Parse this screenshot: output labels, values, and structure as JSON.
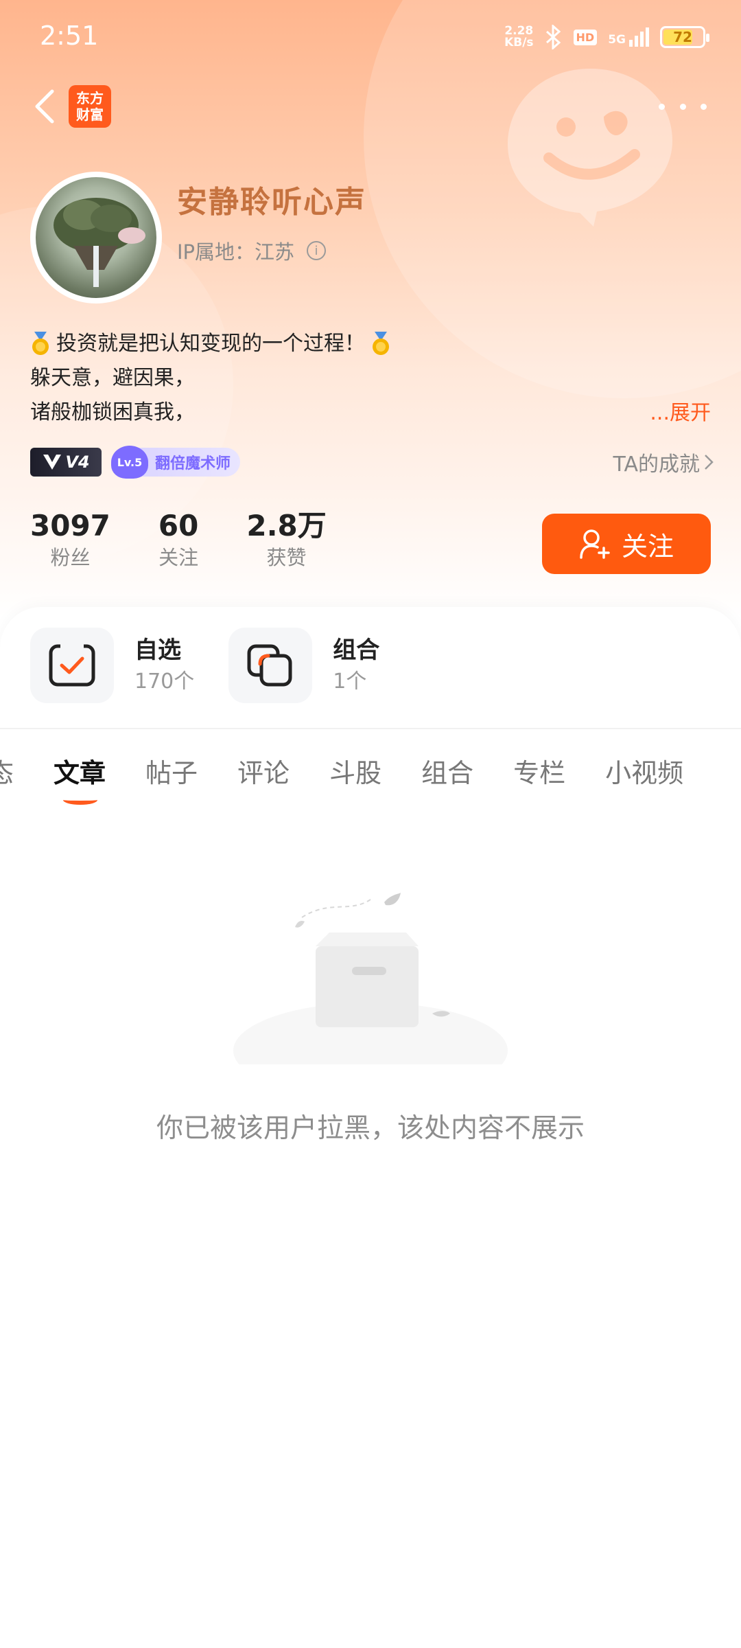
{
  "status_bar": {
    "time": "2:51",
    "net_speed_value": "2.28",
    "net_speed_unit": "KB/s",
    "hd": "HD",
    "signal": "5G",
    "battery": "72"
  },
  "nav": {
    "logo_line1": "东方",
    "logo_line2": "财富"
  },
  "profile": {
    "username": "安静聆听心声",
    "ip_location": "IP属地：江苏",
    "bio_lines": [
      "投资就是把认知变现的一个过程！",
      "躲天意，避因果，",
      "诸般枷锁困真我，"
    ],
    "expand": "...展开",
    "badge_v4": "V4",
    "badge_level": "Lv.5",
    "badge_title": "翻倍魔术师",
    "achievements": "TA的成就"
  },
  "stats": [
    {
      "value": "3097",
      "label": "粉丝"
    },
    {
      "value": "60",
      "label": "关注"
    },
    {
      "value": "2.8万",
      "label": "获赞"
    }
  ],
  "follow_button": "关注",
  "shortcuts": [
    {
      "title": "自选",
      "sub": "170个",
      "icon": "watchlist-icon"
    },
    {
      "title": "组合",
      "sub": "1个",
      "icon": "portfolio-icon"
    }
  ],
  "tabs": [
    "态",
    "文章",
    "帖子",
    "评论",
    "斗股",
    "组合",
    "专栏",
    "小视频"
  ],
  "active_tab": "文章",
  "empty_message": "你已被该用户拉黑，该处内容不展示",
  "colors": {
    "accent": "#ff5a0f",
    "username": "#c5723f"
  }
}
